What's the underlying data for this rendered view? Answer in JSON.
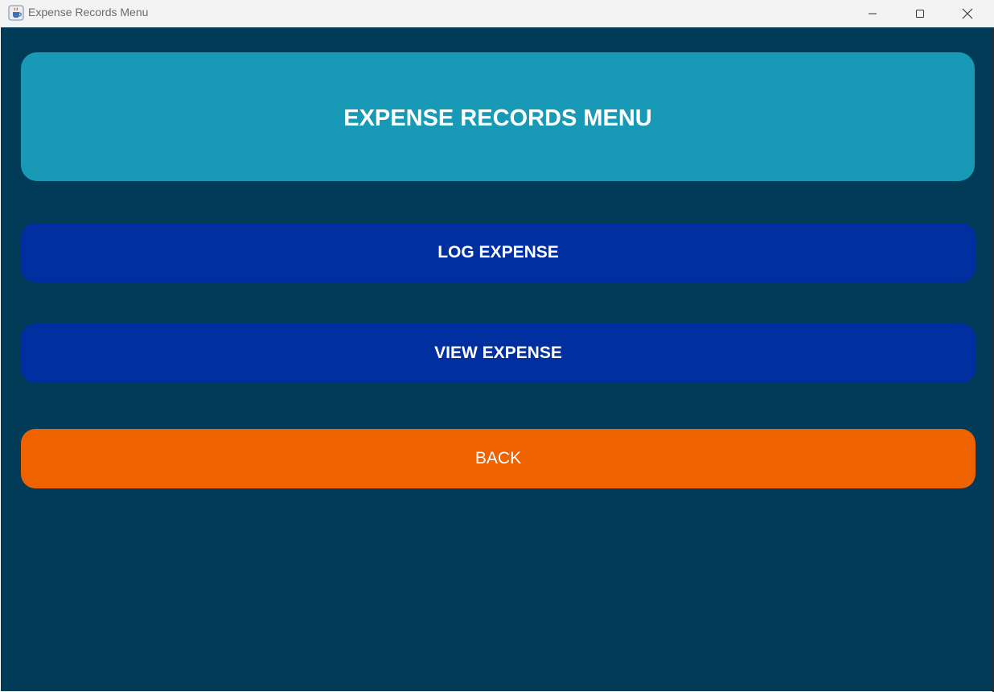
{
  "window": {
    "title": "Expense Records Menu",
    "app_icon": "java-cup-icon"
  },
  "header": {
    "title": "EXPENSE RECORDS MENU"
  },
  "buttons": {
    "log_expense": "LOG EXPENSE",
    "view_expense": "VIEW EXPENSE",
    "back": "BACK"
  },
  "colors": {
    "background": "#023b58",
    "header_panel": "#189ab6",
    "primary_button": "#00309f",
    "back_button": "#ee6200",
    "text": "#ffffff"
  }
}
